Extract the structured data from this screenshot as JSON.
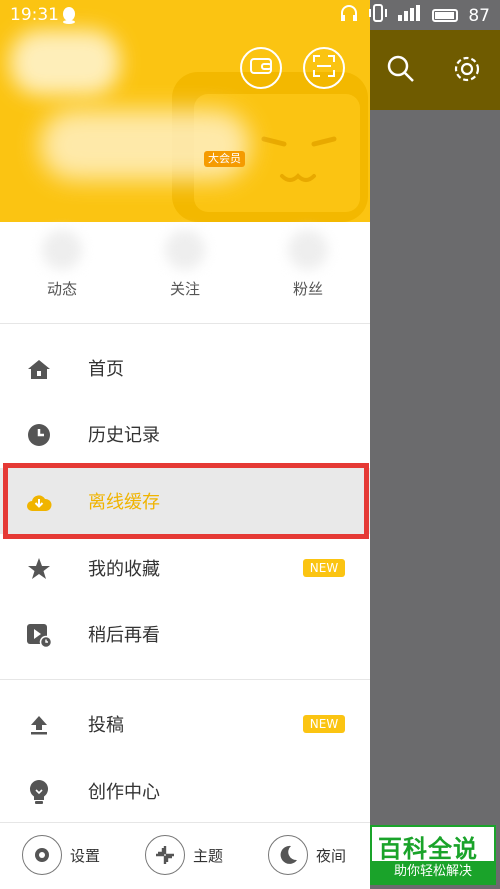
{
  "status_bar": {
    "time": "19:31",
    "battery": "87"
  },
  "header": {
    "vip_label": "大会员"
  },
  "stats": [
    {
      "label": "动态"
    },
    {
      "label": "关注"
    },
    {
      "label": "粉丝"
    }
  ],
  "menu": {
    "items": [
      {
        "label": "首页",
        "icon": "home-icon"
      },
      {
        "label": "历史记录",
        "icon": "clock-icon"
      },
      {
        "label": "离线缓存",
        "icon": "cloud-download-icon",
        "active": true
      },
      {
        "label": "我的收藏",
        "icon": "star-icon",
        "badge": "NEW"
      },
      {
        "label": "稍后再看",
        "icon": "play-later-icon"
      },
      {
        "label": "投稿",
        "icon": "upload-icon",
        "badge": "NEW"
      },
      {
        "label": "创作中心",
        "icon": "bulb-icon"
      }
    ]
  },
  "bottom": {
    "settings": "设置",
    "theme": "主题",
    "night": "夜间"
  },
  "watermark": {
    "title": "百科全说",
    "subtitle": "助你轻松解决"
  },
  "colors": {
    "accent": "#fbc412",
    "active_text": "#f0b400",
    "highlight": "#e53935"
  }
}
